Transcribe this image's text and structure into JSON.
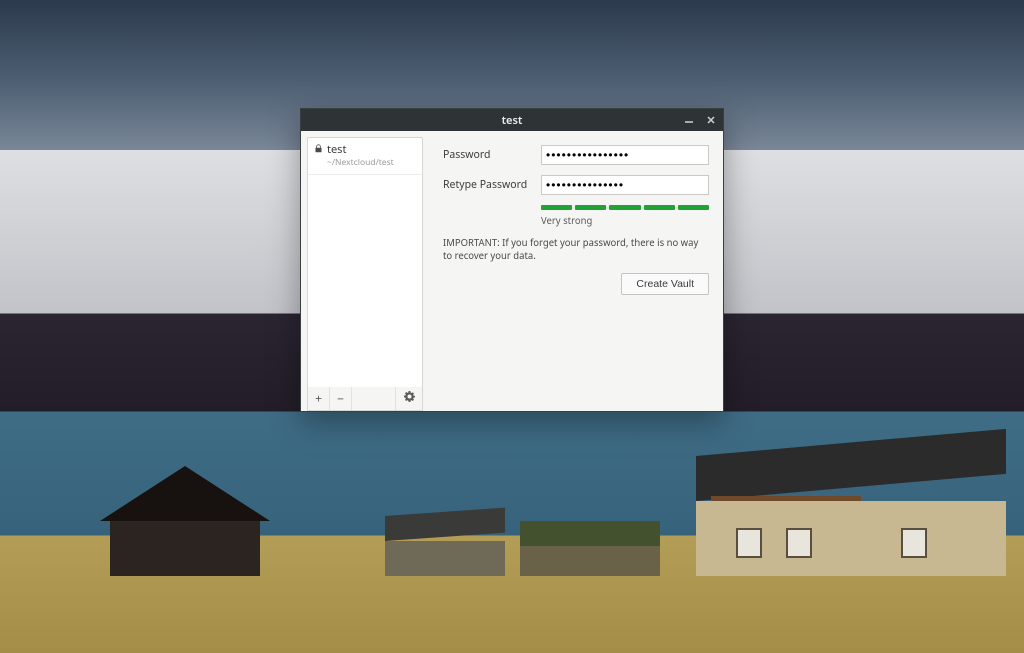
{
  "window": {
    "title": "test"
  },
  "sidebar": {
    "vaults": [
      {
        "name": "test",
        "path": "~/Nextcloud/test"
      }
    ],
    "toolbar": {
      "add_label": "+",
      "remove_label": "−"
    }
  },
  "form": {
    "password_label": "Password",
    "retype_password_label": "Retype Password",
    "password_value": "●●●●●●●●●●●●●●●●",
    "retype_password_value": "●●●●●●●●●●●●●●●",
    "strength_label": "Very strong",
    "strength_segments": 5,
    "warning_text": "IMPORTANT: If you forget your password, there is no way to recover your data.",
    "create_button_label": "Create Vault"
  }
}
